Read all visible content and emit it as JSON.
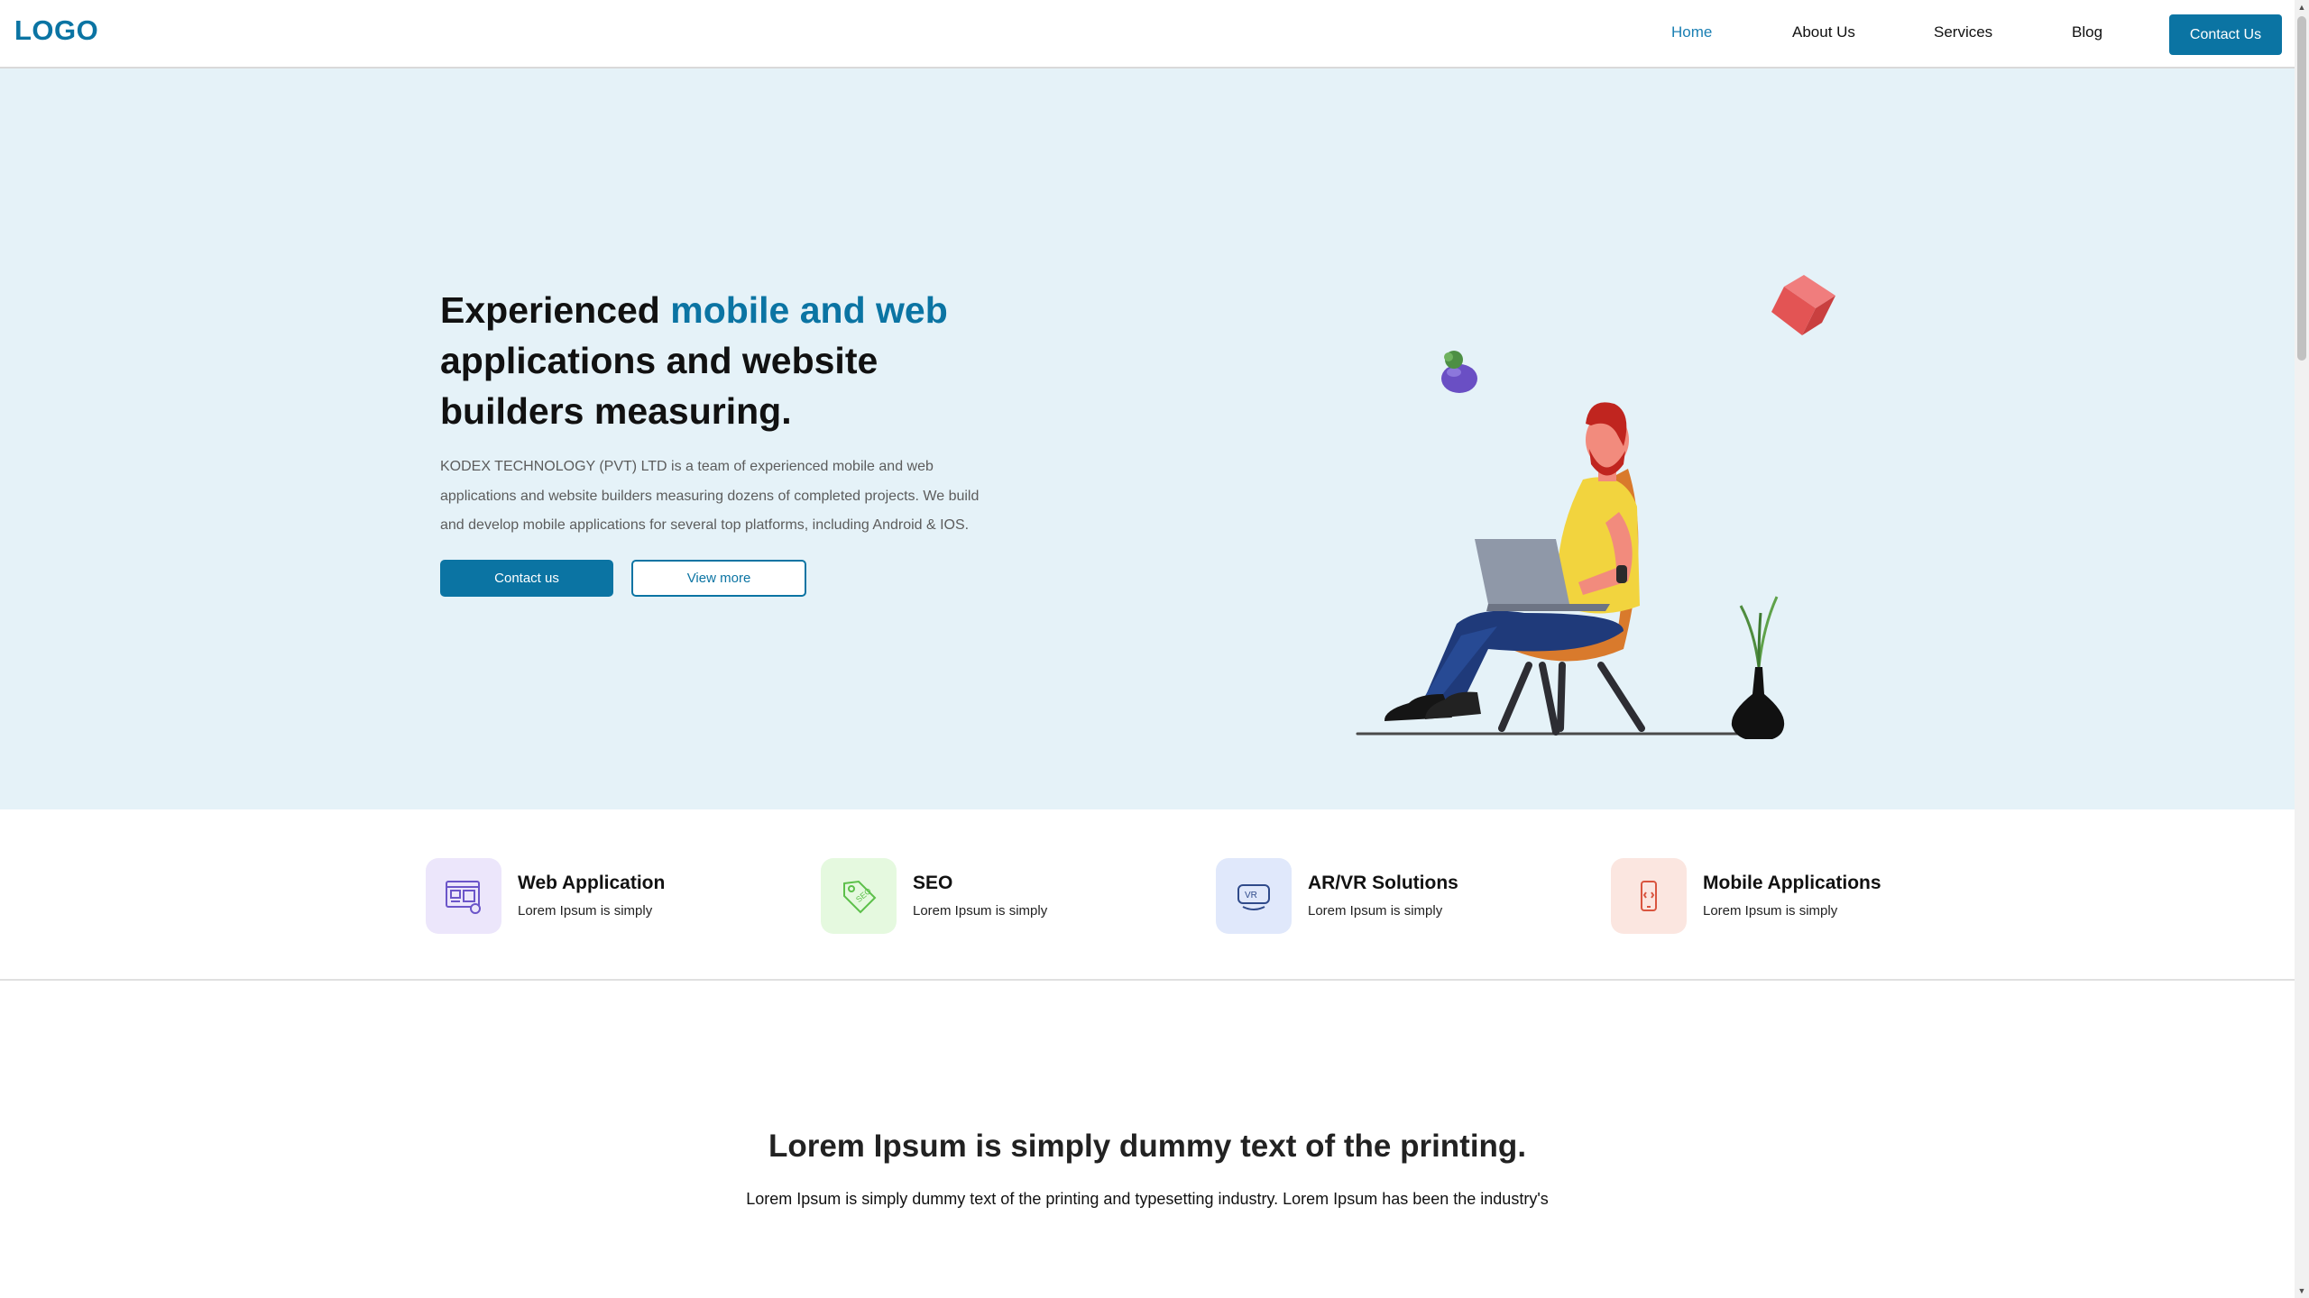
{
  "header": {
    "logo": "LOGO",
    "nav": [
      "Home",
      "About Us",
      "Services",
      "Blog"
    ],
    "cta": "Contact Us"
  },
  "hero": {
    "title_pre": "Experienced ",
    "title_accent": "mobile and web",
    "title_post": " applications and website builders measuring.",
    "description": "KODEX TECHNOLOGY (PVT) LTD is a team of experienced mobile and web applications and website builders measuring dozens of completed projects. We build and develop mobile applications for several top platforms, including Android & IOS.",
    "primary_button": "Contact us",
    "secondary_button": "View more"
  },
  "services": [
    {
      "title": "Web Application",
      "subtitle": "Lorem Ipsum is simply",
      "icon": "web-app-icon",
      "bg": "#ece6fb",
      "color": "#6b55c9"
    },
    {
      "title": "SEO",
      "subtitle": "Lorem Ipsum is simply",
      "icon": "seo-tag-icon",
      "bg": "#e5f9df",
      "color": "#5cc04a"
    },
    {
      "title": "AR/VR Solutions",
      "subtitle": "Lorem Ipsum is simply",
      "icon": "vr-headset-icon",
      "bg": "#e0e8fb",
      "color": "#2f4a8a"
    },
    {
      "title": "Mobile Applications",
      "subtitle": "Lorem Ipsum is simply",
      "icon": "mobile-code-icon",
      "bg": "#fbe6e0",
      "color": "#d9553f"
    }
  ],
  "section": {
    "title": "Lorem Ipsum is simply dummy text of the printing.",
    "text": "Lorem Ipsum is simply dummy text of the printing and typesetting industry. Lorem Ipsum has been the industry's"
  },
  "colors": {
    "accent": "#0b74a3",
    "hero_bg": "#e5f2f8"
  }
}
